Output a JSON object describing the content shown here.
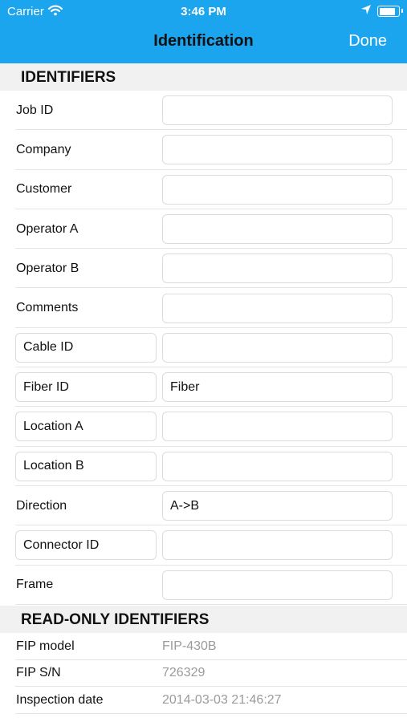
{
  "status_bar": {
    "carrier": "Carrier",
    "time": "3:46 PM",
    "battery_level": 0.9
  },
  "nav": {
    "title": "Identification",
    "done_label": "Done"
  },
  "sections": {
    "identifiers": "IDENTIFIERS",
    "read_only": "READ-ONLY IDENTIFIERS"
  },
  "fields": [
    {
      "label": "Job ID",
      "value": "",
      "editable_label": false
    },
    {
      "label": "Company",
      "value": "",
      "editable_label": false
    },
    {
      "label": "Customer",
      "value": "",
      "editable_label": false
    },
    {
      "label": "Operator A",
      "value": "",
      "editable_label": false
    },
    {
      "label": "Operator B",
      "value": "",
      "editable_label": false
    },
    {
      "label": "Comments",
      "value": "",
      "editable_label": false
    },
    {
      "label": "Cable ID",
      "value": "",
      "editable_label": true
    },
    {
      "label": "Fiber ID",
      "value": "Fiber",
      "editable_label": true
    },
    {
      "label": "Location A",
      "value": "",
      "editable_label": true
    },
    {
      "label": "Location B",
      "value": "",
      "editable_label": true
    },
    {
      "label": "Direction",
      "value": "A->B",
      "editable_label": false
    },
    {
      "label": "Connector ID",
      "value": "",
      "editable_label": true
    },
    {
      "label": "Frame",
      "value": "",
      "editable_label": false
    }
  ],
  "read_only": [
    {
      "label": "FIP model",
      "value": "FIP-430B"
    },
    {
      "label": "FIP S/N",
      "value": "726329"
    },
    {
      "label": "Inspection date",
      "value": "2014-03-03 21:46:27"
    }
  ]
}
